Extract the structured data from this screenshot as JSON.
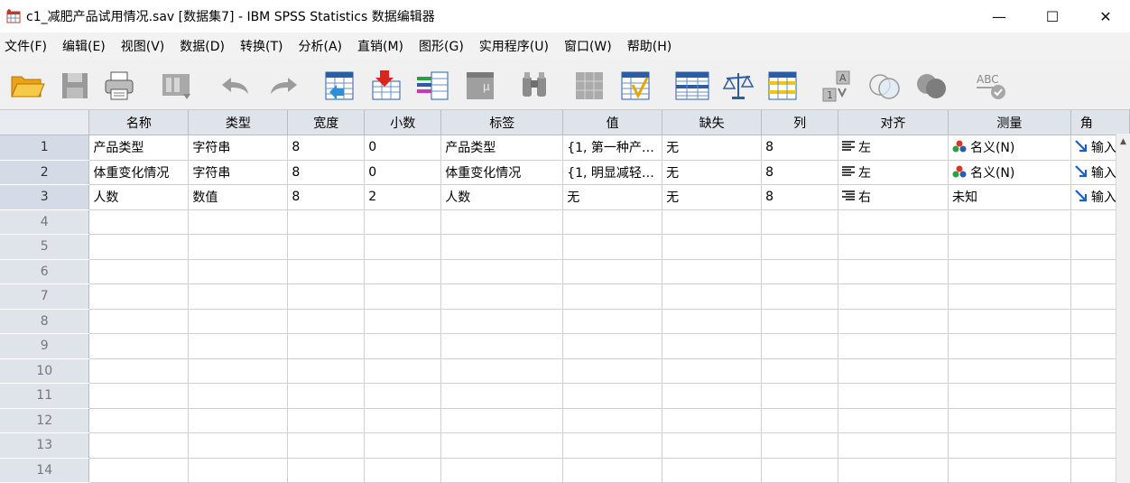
{
  "window": {
    "title": "c1_减肥产品试用情况.sav [数据集7] - IBM SPSS Statistics 数据编辑器",
    "minimize": "—",
    "maximize": "☐",
    "close": "✕"
  },
  "menu": [
    {
      "label": "文件",
      "key": "(F)"
    },
    {
      "label": "编辑",
      "key": "(E)"
    },
    {
      "label": "视图",
      "key": "(V)"
    },
    {
      "label": "数据",
      "key": "(D)"
    },
    {
      "label": "转换",
      "key": "(T)"
    },
    {
      "label": "分析",
      "key": "(A)"
    },
    {
      "label": "直销",
      "key": "(M)"
    },
    {
      "label": "图形",
      "key": "(G)"
    },
    {
      "label": "实用程序",
      "key": "(U)"
    },
    {
      "label": "窗口",
      "key": "(W)"
    },
    {
      "label": "帮助",
      "key": "(H)"
    }
  ],
  "toolbar": [
    "open-folder-icon",
    "save-icon",
    "print-icon",
    "dialog-recall-icon",
    "undo-icon",
    "redo-icon",
    "goto-case-icon",
    "goto-variable-icon",
    "variables-icon",
    "run-descriptives-icon",
    "find-icon",
    "insert-cases-icon",
    "insert-variable-icon",
    "split-file-icon",
    "weight-cases-icon",
    "select-cases-icon",
    "value-labels-icon",
    "use-sets-icon",
    "show-all-variables-icon",
    "spell-check-icon"
  ],
  "grid": {
    "headers": [
      "名称",
      "类型",
      "宽度",
      "小数",
      "标签",
      "值",
      "缺失",
      "列",
      "对齐",
      "测量",
      "角"
    ],
    "rows": [
      {
        "num": "1",
        "name": "产品类型",
        "type": "字符串",
        "width": "8",
        "decimals": "0",
        "label": "产品类型",
        "values": "{1, 第一种产…",
        "missing": "无",
        "columns": "8",
        "align": "左",
        "measure": "名义(N)",
        "role": "输入"
      },
      {
        "num": "2",
        "name": "体重变化情况",
        "type": "字符串",
        "width": "8",
        "decimals": "0",
        "label": "体重变化情况",
        "values": "{1, 明显减轻…",
        "missing": "无",
        "columns": "8",
        "align": "左",
        "measure": "名义(N)",
        "role": "输入"
      },
      {
        "num": "3",
        "name": "人数",
        "type": "数值",
        "width": "8",
        "decimals": "2",
        "label": "人数",
        "values": "无",
        "missing": "无",
        "columns": "8",
        "align": "右",
        "measure": "未知",
        "role": "输入"
      }
    ],
    "empty_rows": [
      "4",
      "5",
      "6",
      "7",
      "8",
      "9",
      "10",
      "11",
      "12",
      "13",
      "14"
    ]
  },
  "colors": {
    "menubar": "#f2f2f2",
    "header": "#dfe3ea",
    "grid_line": "#d0d0d0",
    "role_arrow": "#1f5fbf"
  }
}
